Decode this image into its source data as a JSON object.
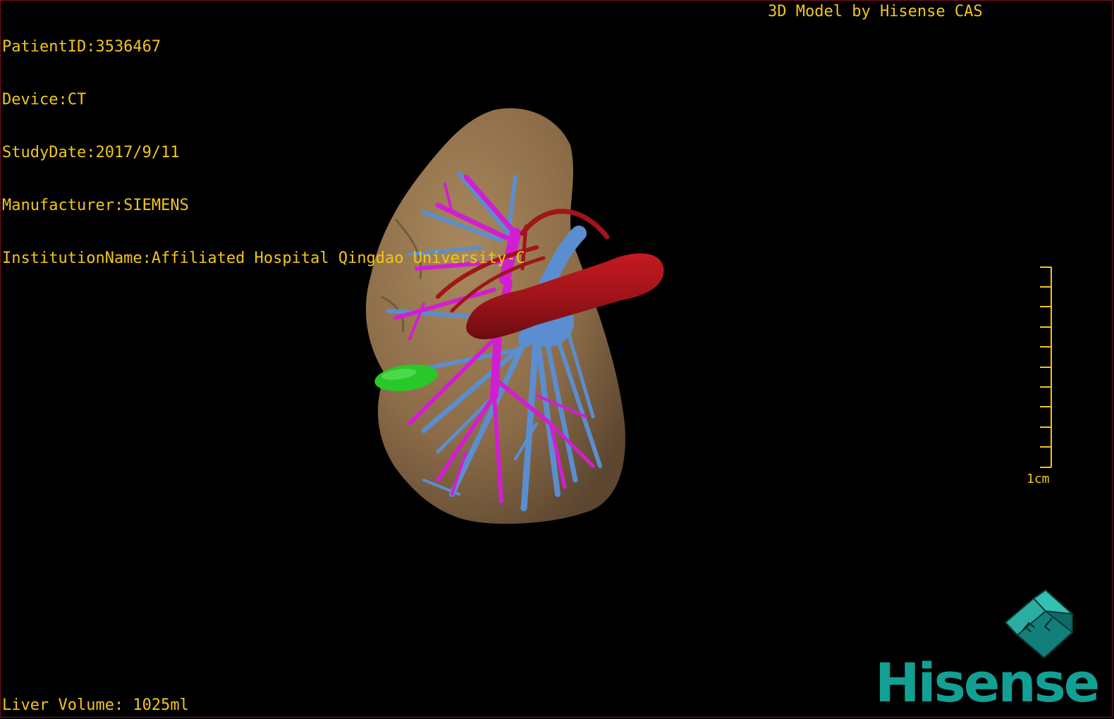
{
  "info": {
    "patient_id": "PatientID:3536467",
    "device": "Device:CT",
    "study_date": "StudyDate:2017/9/11",
    "manufacturer": "Manufacturer:SIEMENS",
    "institution": "InstitutionName:Affiliated Hospital Qingdao University-C"
  },
  "title": "3D Model by Hisense CAS",
  "liver_volume": "Liver Volume: 1025ml",
  "scale": {
    "label": "1cm",
    "color": "#f2c61a"
  },
  "logo": {
    "cube_letters": [
      "F",
      "L"
    ],
    "brand": "Hisense",
    "brand_color": "#12a094"
  },
  "model": {
    "structures": [
      {
        "name": "liver",
        "color": "#8c6c48"
      },
      {
        "name": "hepatic-vein",
        "color": "#5a8ed0"
      },
      {
        "name": "portal-vein",
        "color": "#d21ed2"
      },
      {
        "name": "inferior-vena-cava",
        "color": "#a0141a"
      },
      {
        "name": "lesion",
        "color": "#28c828"
      }
    ]
  }
}
